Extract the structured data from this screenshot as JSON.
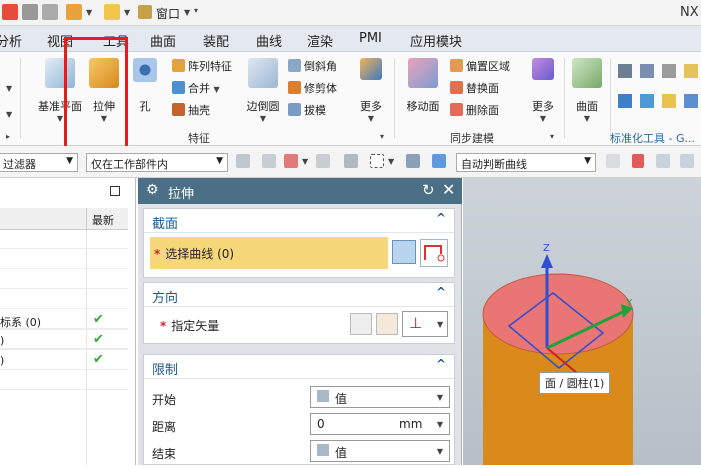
{
  "topbar": {
    "window_menu": "窗口",
    "app_name": "NX"
  },
  "menubar": {
    "items": [
      "分析",
      "视图",
      "工具",
      "曲面",
      "装配",
      "曲线",
      "渲染",
      "PMI",
      "应用模块"
    ]
  },
  "ribbon": {
    "datum_label": "基准平面",
    "extrude_label": "拉伸",
    "hole_label": "孔",
    "pattern_label": "阵列特征",
    "unite_label": "合并",
    "shell_label": "抽壳",
    "edge_blend_label": "边倒圆",
    "chamfer_label": "倒斜角",
    "trim_body_label": "修剪体",
    "draft_label": "拔模",
    "more_label": "更多",
    "move_face_label": "移动面",
    "offset_region_label": "偏置区域",
    "replace_face_label": "替换面",
    "delete_face_label": "删除面",
    "more2_label": "更多",
    "surface_label": "曲面",
    "feature_group": "特征",
    "sync_group": "同步建模",
    "std_tools_group": "标准化工具 - G..."
  },
  "filterbar": {
    "filter_value": "过滤器",
    "scope_value": "仅在工作部件内",
    "curve_rule_value": "自动判断曲线"
  },
  "navigator": {
    "latest_header": "最新",
    "rows": [
      "",
      "",
      "",
      "",
      "",
      "",
      "标系 (0)",
      ")",
      ")",
      ""
    ]
  },
  "dialog": {
    "title": "拉伸",
    "section_label": "截面",
    "select_curve_label": "选择曲线 (0)",
    "direction_label": "方向",
    "specify_vector_label": "指定矢量",
    "limits_label": "限制",
    "start_label": "开始",
    "start_value": "值",
    "distance_label": "距离",
    "distance_value": "0",
    "distance_unit": "mm",
    "end_label": "结束",
    "end_value": "值"
  },
  "viewport": {
    "z_label": "Z",
    "y_label": "Y",
    "tooltip": "面 / 圆柱(1)"
  },
  "colors": {
    "highlight_box": "#e51c1c",
    "dialog_header": "#4b6f86",
    "selection_fill": "#f6d77a",
    "cylinder": "#d98a1b",
    "cylinder_top": "#e97575"
  }
}
